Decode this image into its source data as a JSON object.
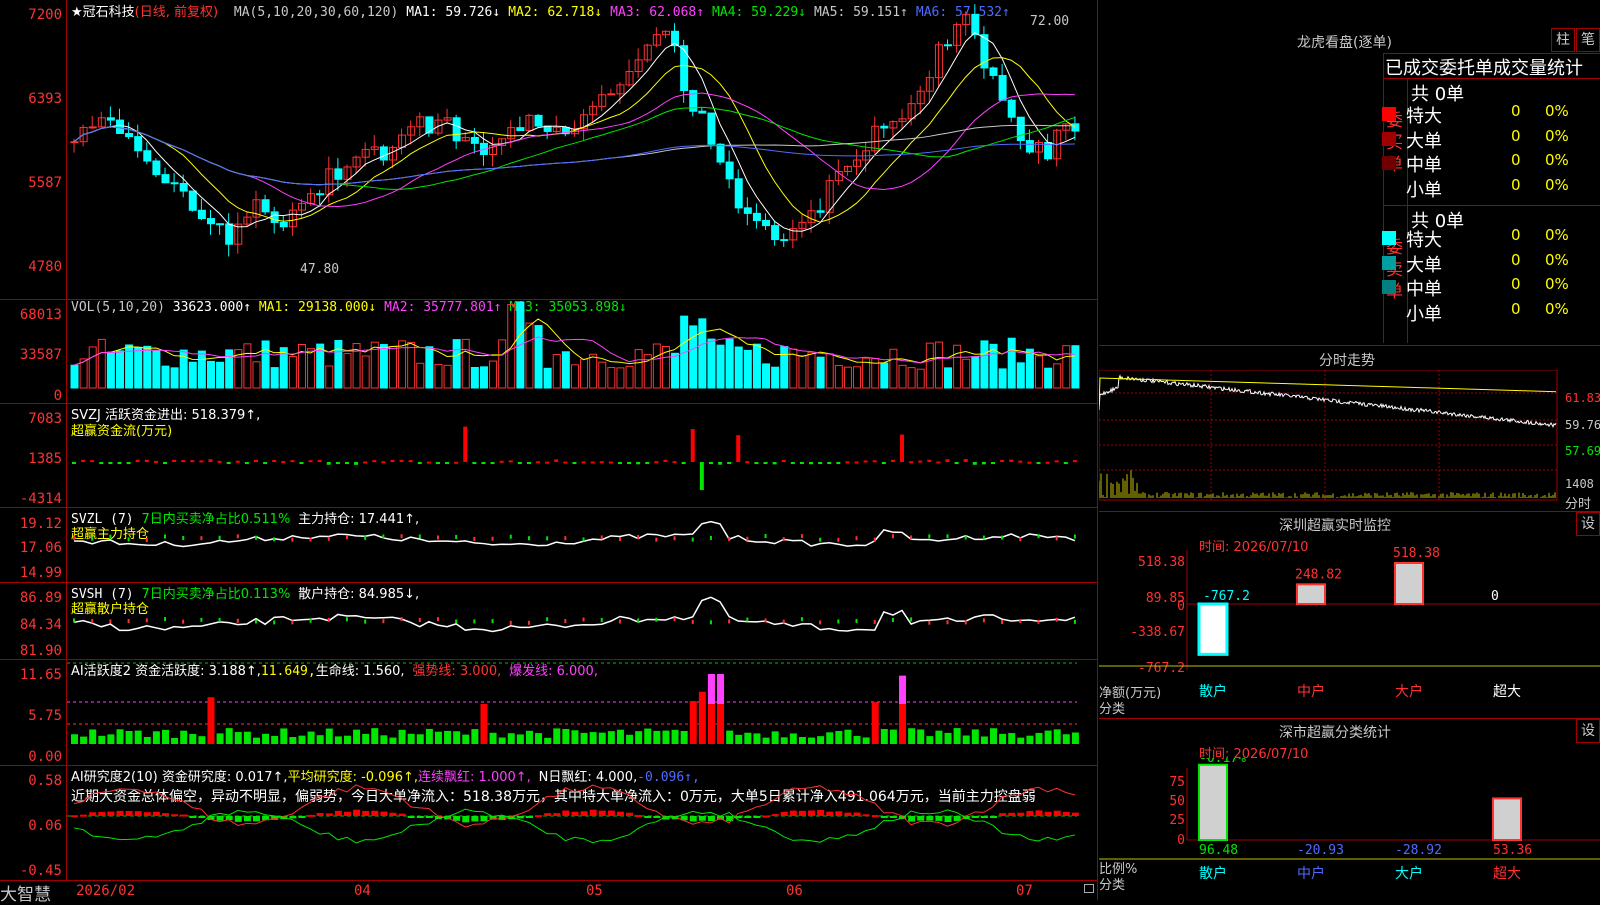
{
  "stock": {
    "title": "★冠石科技",
    "period": "(日线, 前复权)",
    "ma_legend": [
      {
        "label": "MA(5,10,20,30,60,120)",
        "value": "",
        "color": "#c8c8c8"
      },
      {
        "label": "MA1:",
        "value": "59.726↓",
        "color": "#ffffff"
      },
      {
        "label": "MA2:",
        "value": "62.718↓",
        "color": "#ffff00"
      },
      {
        "label": "MA3:",
        "value": "62.068↑",
        "color": "#ff40ff"
      },
      {
        "label": "MA4:",
        "value": "59.229↓",
        "color": "#00e600"
      },
      {
        "label": "MA5:",
        "value": "59.151↑",
        "color": "#c8c8c8"
      },
      {
        "label": "MA6:",
        "value": "57.532↑",
        "color": "#4f6bff"
      }
    ],
    "price_axis": [
      "7200",
      "6393",
      "5587",
      "4780"
    ],
    "high_label": "72.00",
    "low_label": "47.80"
  },
  "vol": {
    "legend": "VOL(5,10,20)",
    "value": "33623.000↑",
    "ma1": "MA1: 29138.000↓",
    "ma2": "MA2: 35777.801↑",
    "ma3": "MA3: 35053.898↓",
    "axis": [
      "68013",
      "33587",
      "0"
    ]
  },
  "svzj": {
    "legend": "SVZJ  活跃资金进出: 518.379↑,",
    "sub": "超赢资金流(万元)",
    "axis": [
      "7083",
      "1385",
      "-4314"
    ]
  },
  "svzl": {
    "legend_a": "SVZL (7)",
    "legend_b": "7日内买卖净占比0.511%",
    "legend_c": "主力持仓: 17.441↑,",
    "sub": "超赢主力持仓",
    "axis": [
      "19.12",
      "17.06",
      "14.99"
    ]
  },
  "svsh": {
    "legend_a": "SVSH (7)",
    "legend_b": "7日内买卖净占比0.113%",
    "legend_c": "散户持仓: 84.985↓,",
    "sub": "超赢散户持仓",
    "axis": [
      "86.89",
      "84.34",
      "81.90"
    ]
  },
  "ai_active": {
    "legend_a": "AI活跃度2 资金活跃度: 3.188↑,",
    "legend_b": "11.649,",
    "legend_c": "生命线: 1.560,",
    "legend_d": "强势线: 3.000,",
    "legend_e": "爆发线: 6.000,",
    "axis": [
      "11.65",
      "5.75",
      "0.00"
    ]
  },
  "ai_research": {
    "legend_a": "AI研究度2(10) 资金研究度: 0.017↑,",
    "legend_b": "平均研究度: -0.096↑,",
    "legend_c": "连续飘红: 1.000↑,",
    "legend_d": "N日飘红: 4.000,",
    "legend_e": "-0.096↑,",
    "summary": "近期大资金总体偏空，异动不明显，偏弱势，今日大单净流入：518.38万元，其中特大单净流入：0万元，大单5日累计净入491.064万元，当前主力控盘弱",
    "axis": [
      "0.58",
      "0.06",
      "-0.45"
    ]
  },
  "time_axis": [
    "2026/02",
    "04",
    "05",
    "06",
    "07"
  ],
  "brand": "大智慧",
  "longhu": {
    "title": "龙虎看盘(逐单)",
    "btn1": "柱",
    "btn2": "笔",
    "tabs": "已成交委托单成交量统计",
    "buy_label": "委买单",
    "sell_label": "委卖单",
    "buy_total": "共 0单",
    "sell_total": "共 0单",
    "buy_rows": [
      {
        "name": "特大",
        "count": "0",
        "pct": "0%",
        "color": "#ff0000"
      },
      {
        "name": "大单",
        "count": "0",
        "pct": "0%",
        "color": "#a00000"
      },
      {
        "name": "中单",
        "count": "0",
        "pct": "0%",
        "color": "#700000"
      },
      {
        "name": "小单",
        "count": "0",
        "pct": "0%",
        "color": ""
      }
    ],
    "sell_rows": [
      {
        "name": "特大",
        "count": "0",
        "pct": "0%",
        "color": "#00ffff"
      },
      {
        "name": "大单",
        "count": "0",
        "pct": "0%",
        "color": "#00a0a0"
      },
      {
        "name": "中单",
        "count": "0",
        "pct": "0%",
        "color": "#008080"
      },
      {
        "name": "小单",
        "count": "0",
        "pct": "0%",
        "color": ""
      }
    ]
  },
  "intraday": {
    "title": "分时走势",
    "axis": [
      "61.83",
      "59.76",
      "57.69",
      "1408",
      "分时"
    ]
  },
  "sz_monitor": {
    "title": "深圳超赢实时监控",
    "set": "设",
    "time": "时间: 2026/07/10",
    "axis": [
      "518.38",
      "89.85",
      "0",
      "-338.67",
      "-767.2"
    ],
    "unit": "净额(万元)",
    "category": "分类",
    "bars": [
      {
        "name": "散户",
        "value": "-767.2",
        "v": -767.2
      },
      {
        "name": "中户",
        "value": "248.82",
        "v": 248.82
      },
      {
        "name": "大户",
        "value": "518.38",
        "v": 518.38
      },
      {
        "name": "超大",
        "value": "0",
        "v": 0
      }
    ]
  },
  "sz_class": {
    "title": "深市超赢分类统计",
    "set": "设",
    "time": "时间: 2026/07/10",
    "axis": [
      "75",
      "50",
      "25",
      "0"
    ],
    "unit": "比例%",
    "category": "分类",
    "top_label": "-0.17%",
    "bars": [
      {
        "name": "散户",
        "value": "96.48",
        "v": 96.48
      },
      {
        "name": "中户",
        "value": "-20.93",
        "v": -20.93
      },
      {
        "name": "大户",
        "value": "-28.92",
        "v": -28.92
      },
      {
        "name": "超大",
        "value": "53.36",
        "v": 53.36
      }
    ]
  },
  "colors": {
    "up": "#ff3232",
    "down": "#00ffff",
    "grid": "#a00000"
  }
}
